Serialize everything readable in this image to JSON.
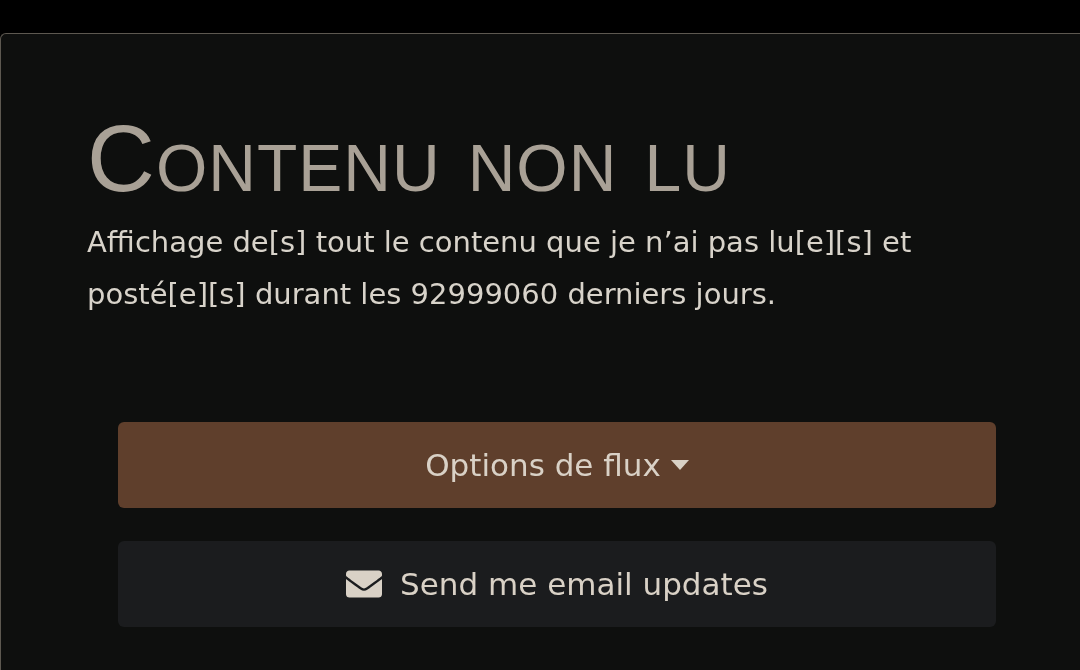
{
  "title": "Contenu non lu",
  "description": "Affichage de[s] tout le contenu que je n’ai pas lu[e][s] et posté[e][s] durant les 92999060 derniers jours.",
  "buttons": [
    {
      "kind": "dropdown",
      "label": "Options de flux"
    },
    {
      "kind": "email",
      "label": "Send me email updates"
    }
  ]
}
